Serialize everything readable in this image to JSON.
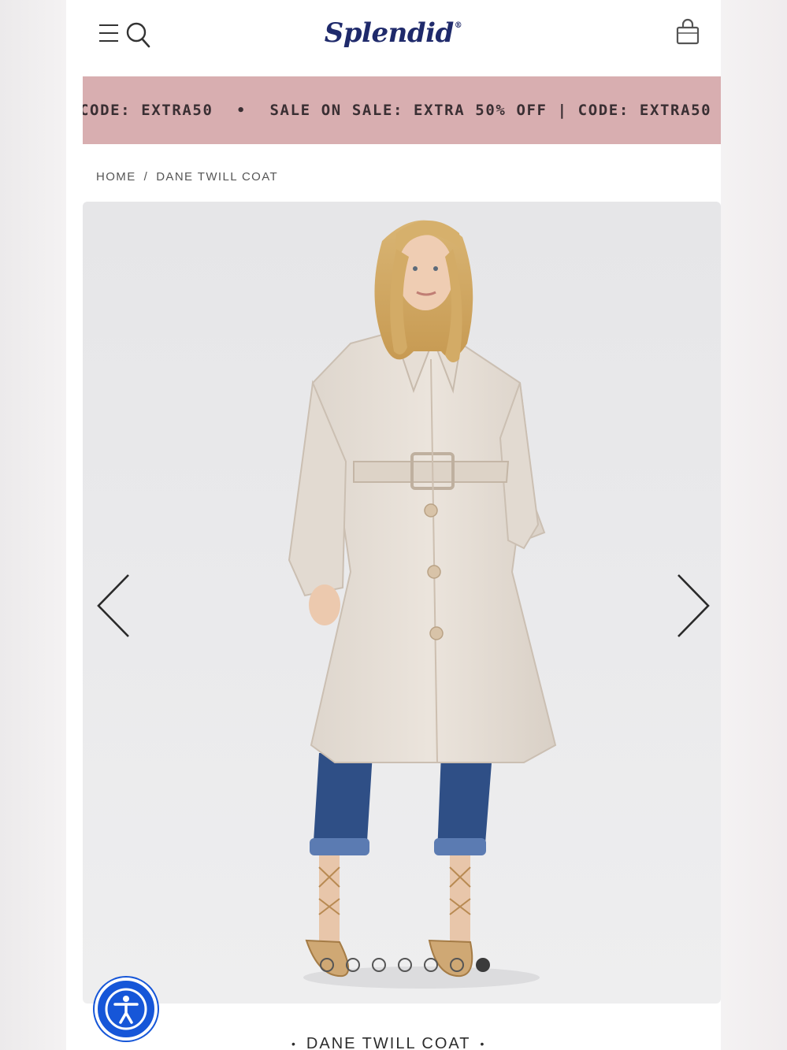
{
  "header": {
    "logo_text": "Splendid",
    "logo_mark": "®"
  },
  "promo_banner": {
    "segments": [
      "CODE: EXTRA50",
      "SALE ON SALE: EXTRA 50% OFF | CODE: EXTRA50"
    ],
    "separator": "•",
    "background": "#d8aeb0"
  },
  "breadcrumb": {
    "home": "HOME",
    "separator": "/",
    "current": "DANE TWILL COAT"
  },
  "carousel": {
    "slide_count": 7,
    "active_index": 6,
    "image_subject": "Model wearing a beige belted trench coat with cuffed blue jeans and strappy sandals"
  },
  "product": {
    "title": "DANE TWILL COAT",
    "title_bullet": "•"
  },
  "colors": {
    "brand": "#1f2a6b",
    "a11y": "#1656d8"
  }
}
